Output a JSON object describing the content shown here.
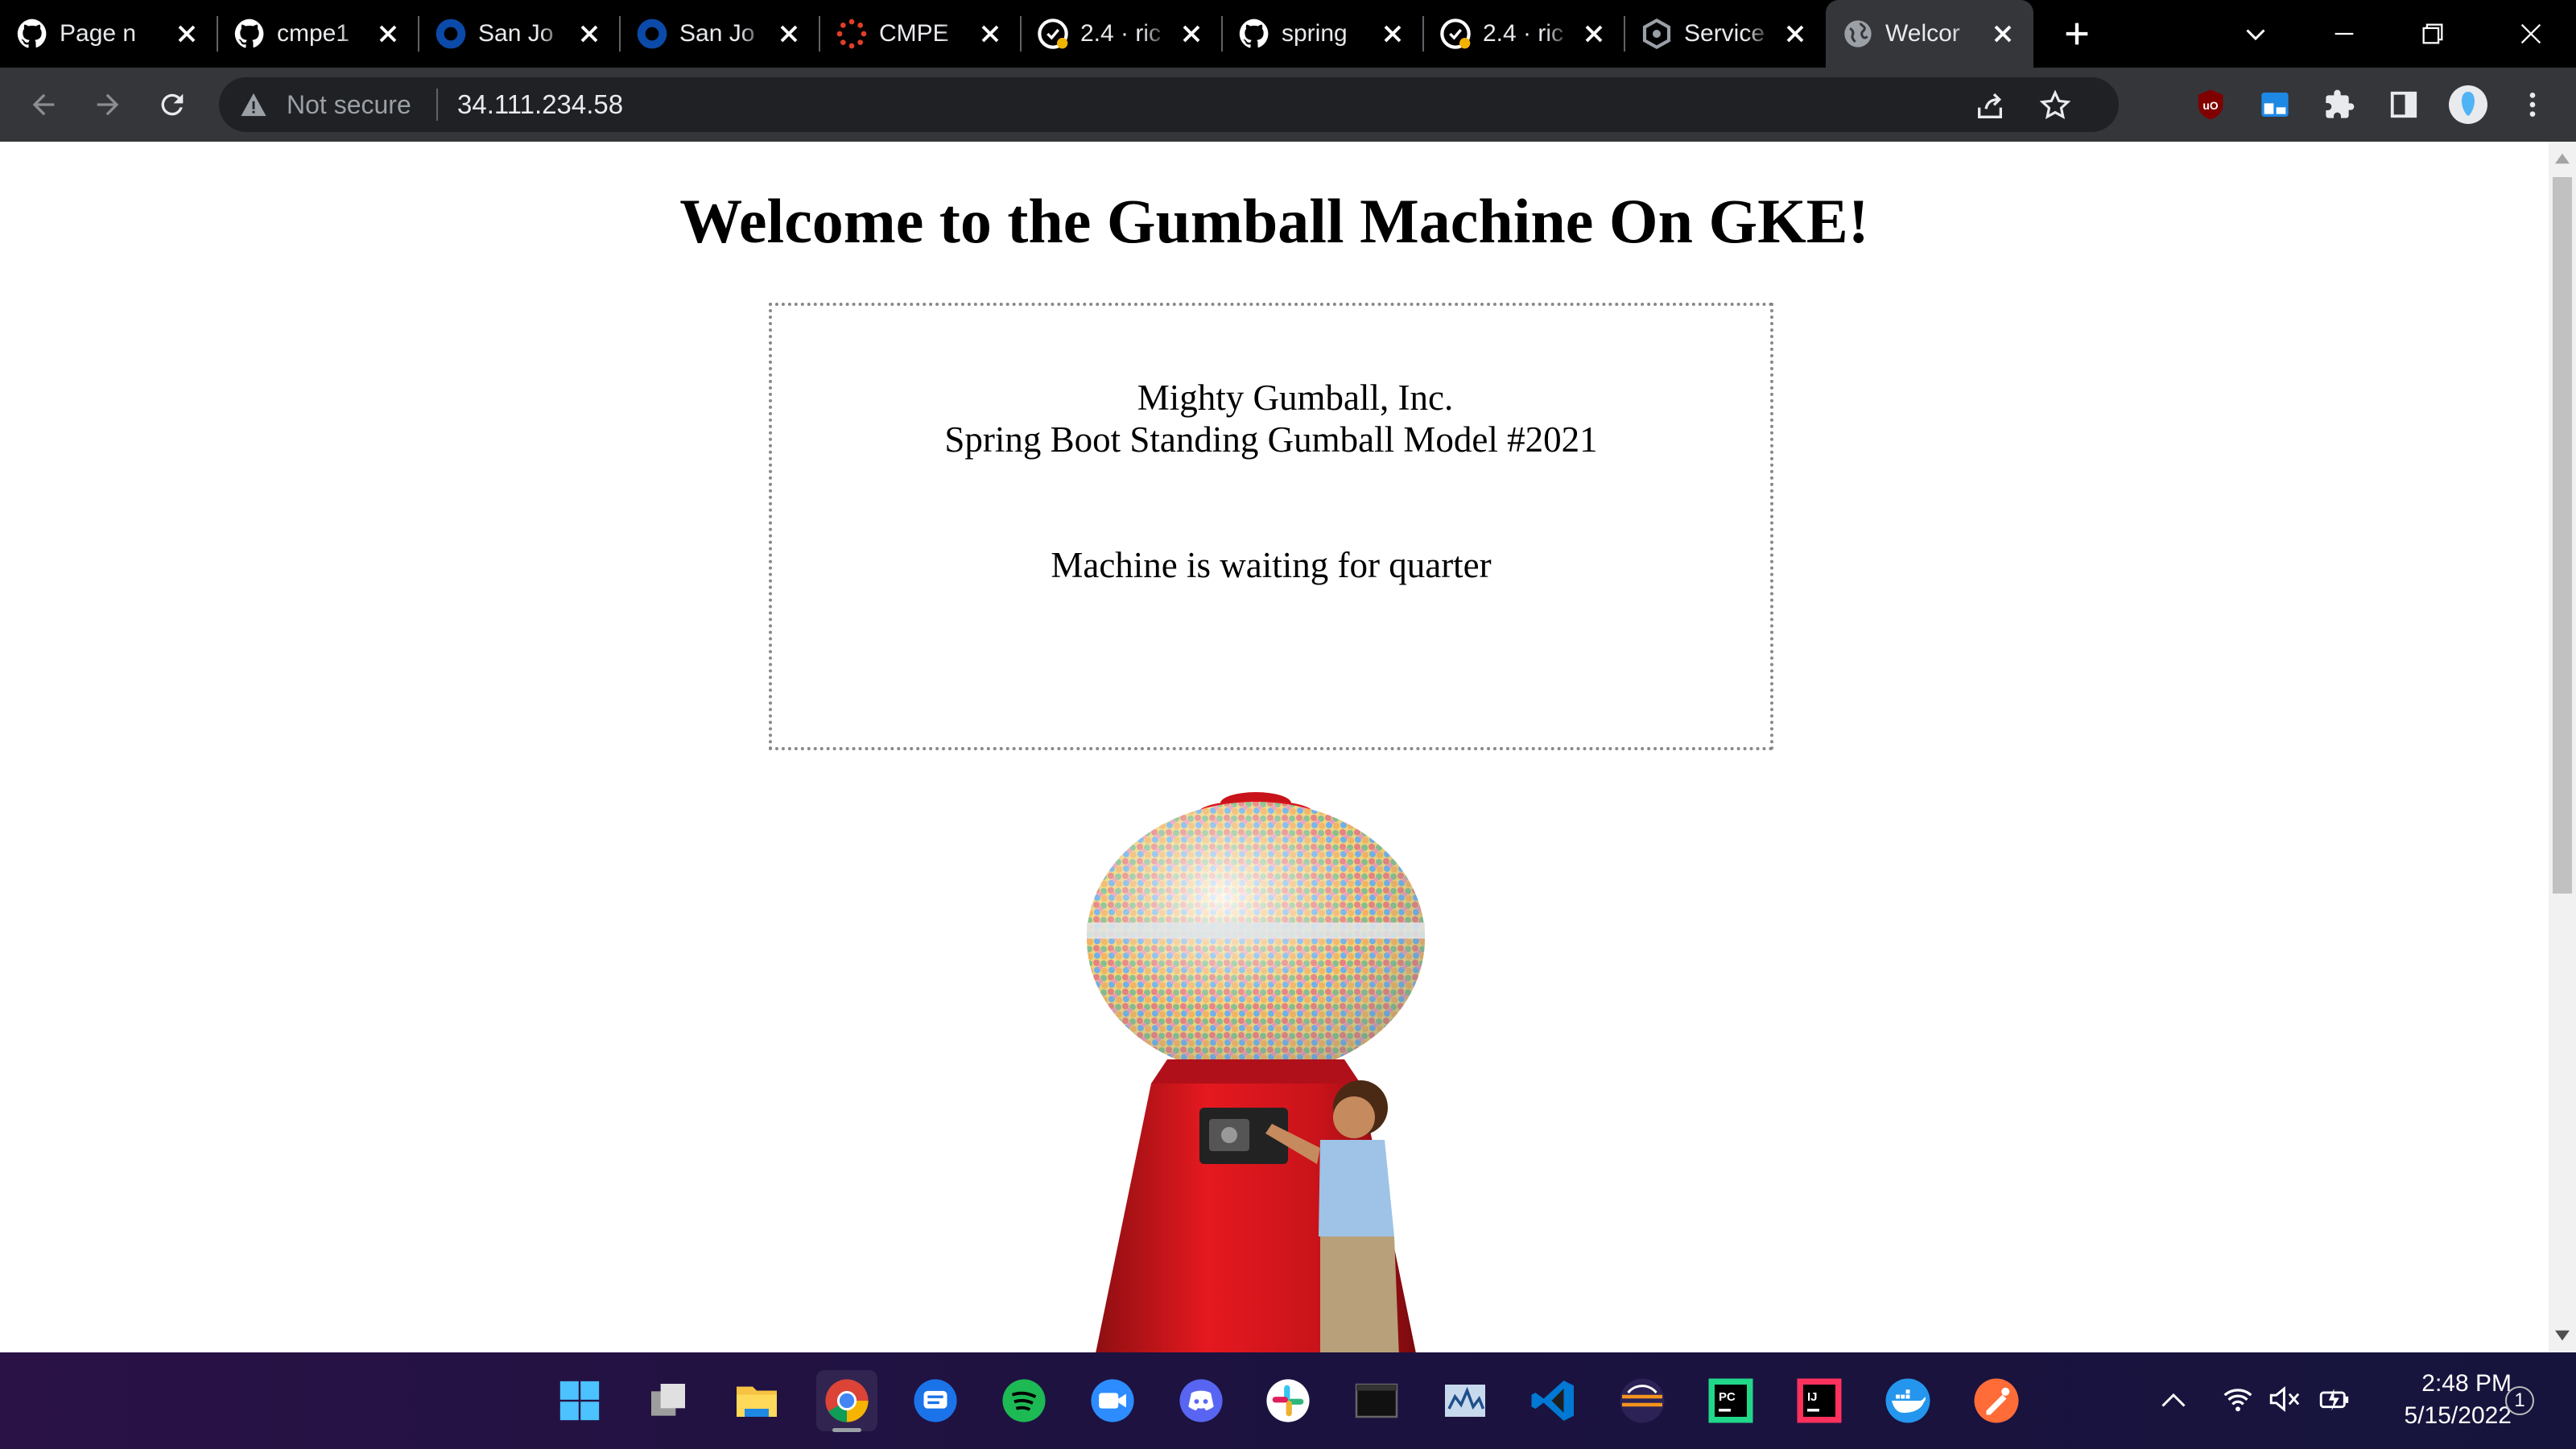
{
  "tabs": [
    {
      "title": "Page n",
      "icon": "github-icon"
    },
    {
      "title": "cmpe1",
      "icon": "github-icon"
    },
    {
      "title": "San Jo",
      "icon": "circle-logo-icon"
    },
    {
      "title": "San Jo",
      "icon": "circle-logo-icon"
    },
    {
      "title": "CMPE",
      "icon": "canvas-icon"
    },
    {
      "title": "2.4 · ric",
      "icon": "github-status-icon"
    },
    {
      "title": "spring",
      "icon": "github-icon"
    },
    {
      "title": "2.4 · ric",
      "icon": "github-status-icon"
    },
    {
      "title": "Service",
      "icon": "gke-icon"
    },
    {
      "title": "Welcor",
      "icon": "globe-icon",
      "active": true
    }
  ],
  "toolbar": {
    "security_label": "Not secure",
    "url": "34.111.234.58"
  },
  "page": {
    "title": "Welcome to the Gumball Machine On GKE!",
    "company": "Mighty Gumball, Inc.",
    "model": "Spring Boot Standing Gumball Model #2021",
    "status": "Machine is waiting for quarter"
  },
  "taskbar": {
    "apps": [
      "start-icon",
      "task-view-icon",
      "file-explorer-icon",
      "chrome-icon",
      "messages-icon",
      "spotify-icon",
      "zoom-icon",
      "discord-icon",
      "slack-icon",
      "terminal-icon",
      "resource-monitor-icon",
      "vscode-icon",
      "eclipse-icon",
      "pycharm-icon",
      "intellij-icon",
      "docker-icon",
      "postman-icon"
    ],
    "time": "2:48 PM",
    "date": "5/15/2022",
    "notification_count": "1"
  },
  "colors": {
    "tabstrip": "#000000",
    "toolbar": "#35363a",
    "omnibox": "#202124",
    "gumball_red": "#d7141a"
  }
}
